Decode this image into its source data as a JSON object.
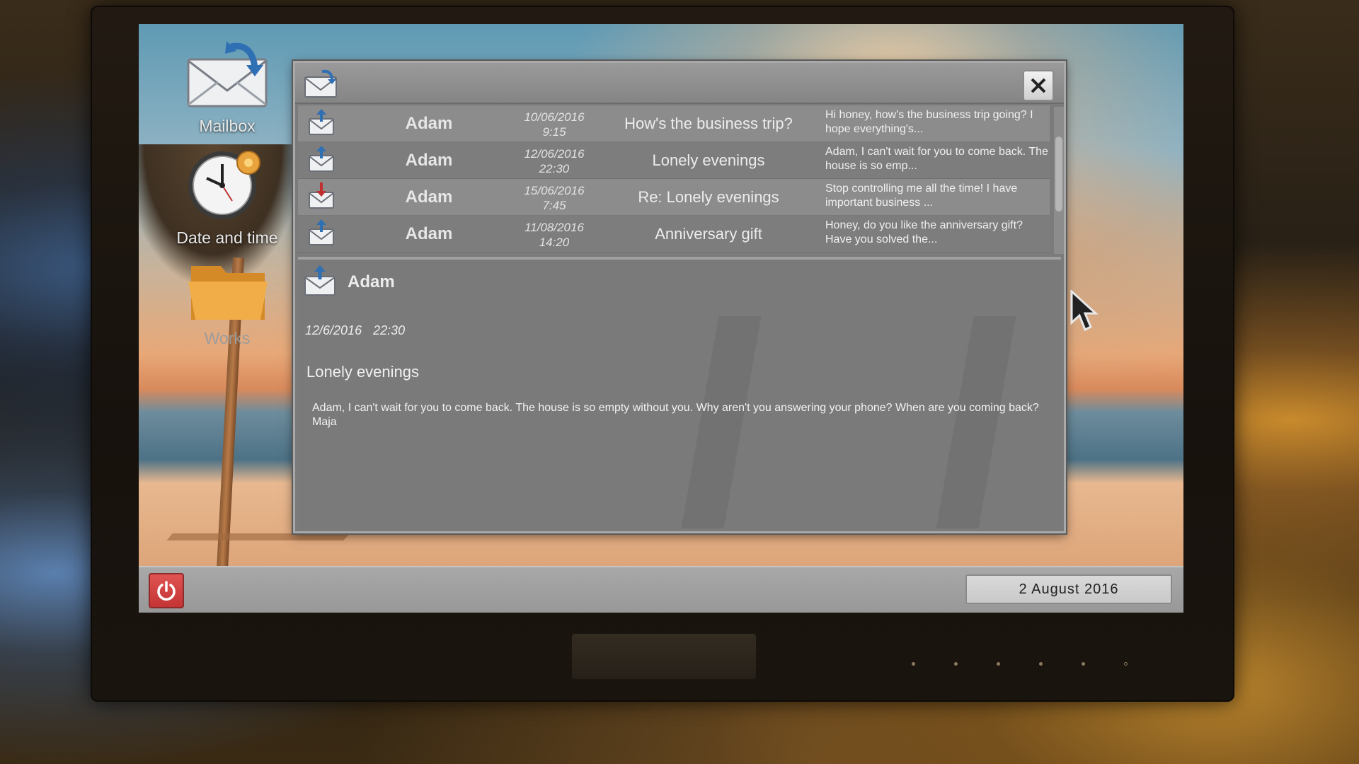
{
  "desktop": {
    "icons": [
      {
        "label": "Mailbox"
      },
      {
        "label": "Date and time"
      },
      {
        "label": "Works"
      }
    ]
  },
  "mail_window": {
    "messages": [
      {
        "direction": "incoming",
        "sender": "Adam",
        "date": "10/06/2016",
        "time": "9:15",
        "subject": "How's the business trip?",
        "preview": "Hi honey, how's the business trip going? I hope everything's..."
      },
      {
        "direction": "incoming",
        "sender": "Adam",
        "date": "12/06/2016",
        "time": "22:30",
        "subject": "Lonely evenings",
        "preview": "Adam, I can't wait for you to come back. The house is so emp..."
      },
      {
        "direction": "outgoing",
        "sender": "Adam",
        "date": "15/06/2016",
        "time": "7:45",
        "subject": "Re: Lonely evenings",
        "preview": "Stop controlling me all the time! I have important business ..."
      },
      {
        "direction": "incoming",
        "sender": "Adam",
        "date": "11/08/2016",
        "time": "14:20",
        "subject": "Anniversary gift",
        "preview": "Honey, do you like the anniversary gift? Have you solved the..."
      }
    ],
    "detail": {
      "sender": "Adam",
      "date": "12/6/2016",
      "time": "22:30",
      "subject": "Lonely evenings",
      "body": "Adam, I can't wait for you to come back. The house is so empty without you. Why aren't you answering your phone? When are you coming back? Maja"
    }
  },
  "taskbar": {
    "date": "2 August 2016"
  },
  "colors": {
    "incoming_arrow": "#2f6fb3",
    "outgoing_arrow": "#c03030",
    "power_button": "#d04444",
    "folder": "#e8a33c"
  }
}
